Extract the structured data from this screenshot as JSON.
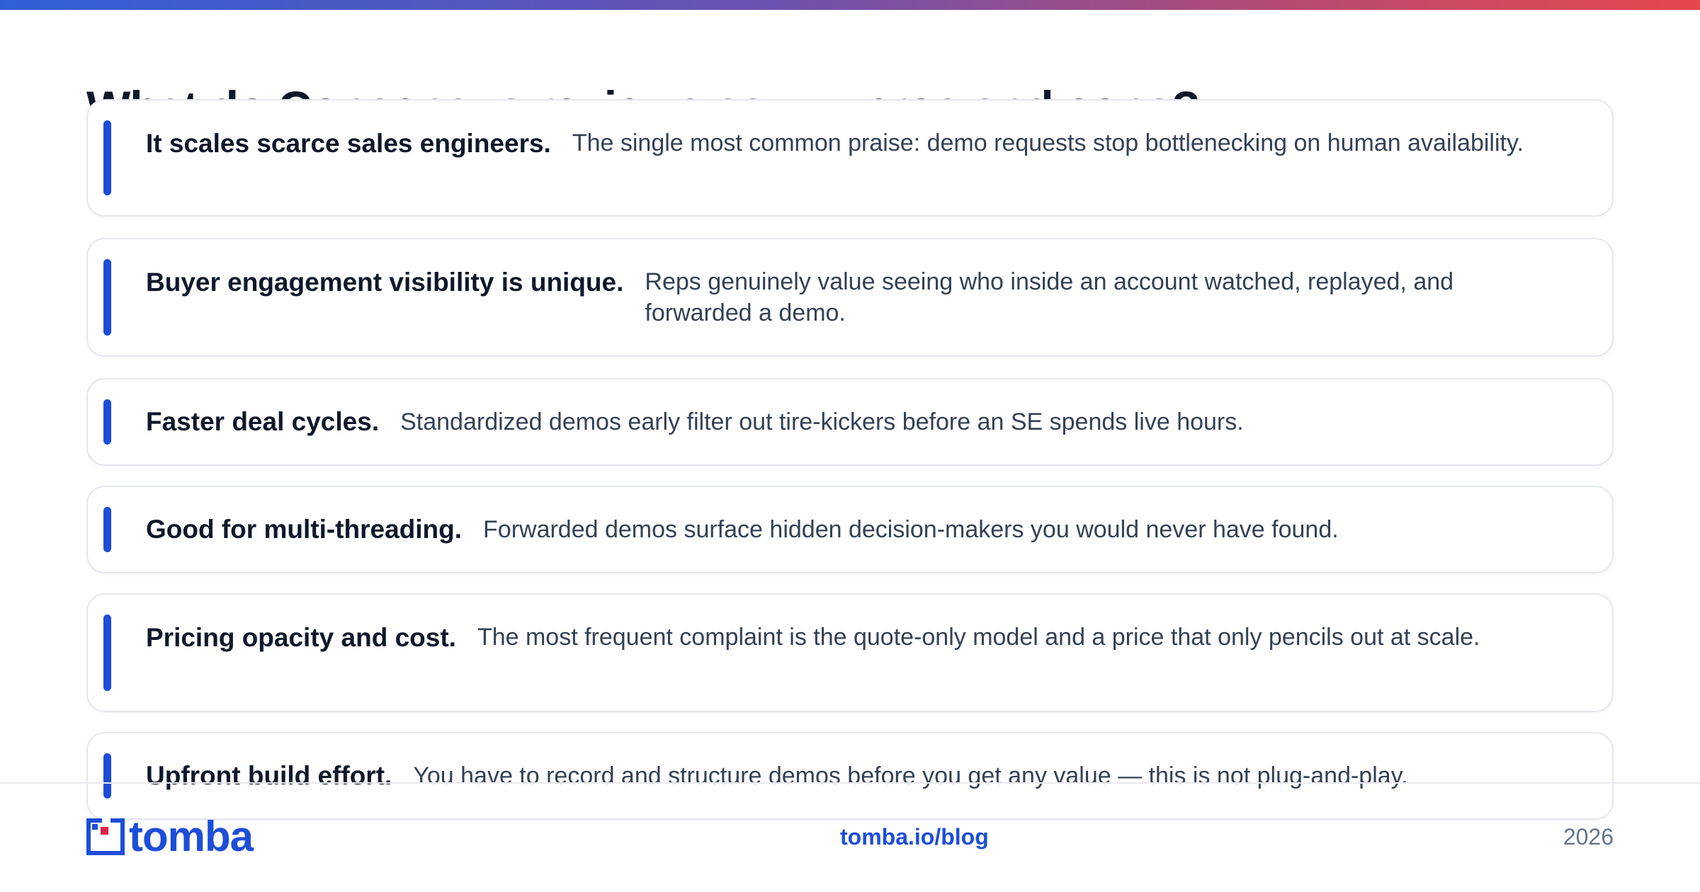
{
  "page": {
    "title": "What do Consensus reviews say — pros and cons?"
  },
  "points": [
    {
      "heading": "It scales scarce sales engineers.",
      "text": "The single most common praise: demo requests stop bottlenecking on human availability."
    },
    {
      "heading": "Buyer engagement visibility is unique.",
      "text": "Reps genuinely value seeing who inside an account watched, replayed, and forwarded a demo."
    },
    {
      "heading": "Faster deal cycles.",
      "text": "Standardized demos early filter out tire-kickers before an SE spends live hours."
    },
    {
      "heading": "Good for multi-threading.",
      "text": "Forwarded demos surface hidden decision-makers you would never have found."
    },
    {
      "heading": "Pricing opacity and cost.",
      "text": "The most frequent complaint is the quote-only model and a price that only pencils out at scale."
    },
    {
      "heading": "Upfront build effort.",
      "text": "You have to record and structure demos before you get any value — this is not plug-and-play."
    }
  ],
  "footer": {
    "logo_text": "tomba",
    "link": "tomba.io/blog",
    "year": "2026"
  },
  "colors": {
    "accent": "#1d4ed8",
    "logo_red": "#e11d48",
    "heading": "#0f172a",
    "body": "#334155"
  }
}
